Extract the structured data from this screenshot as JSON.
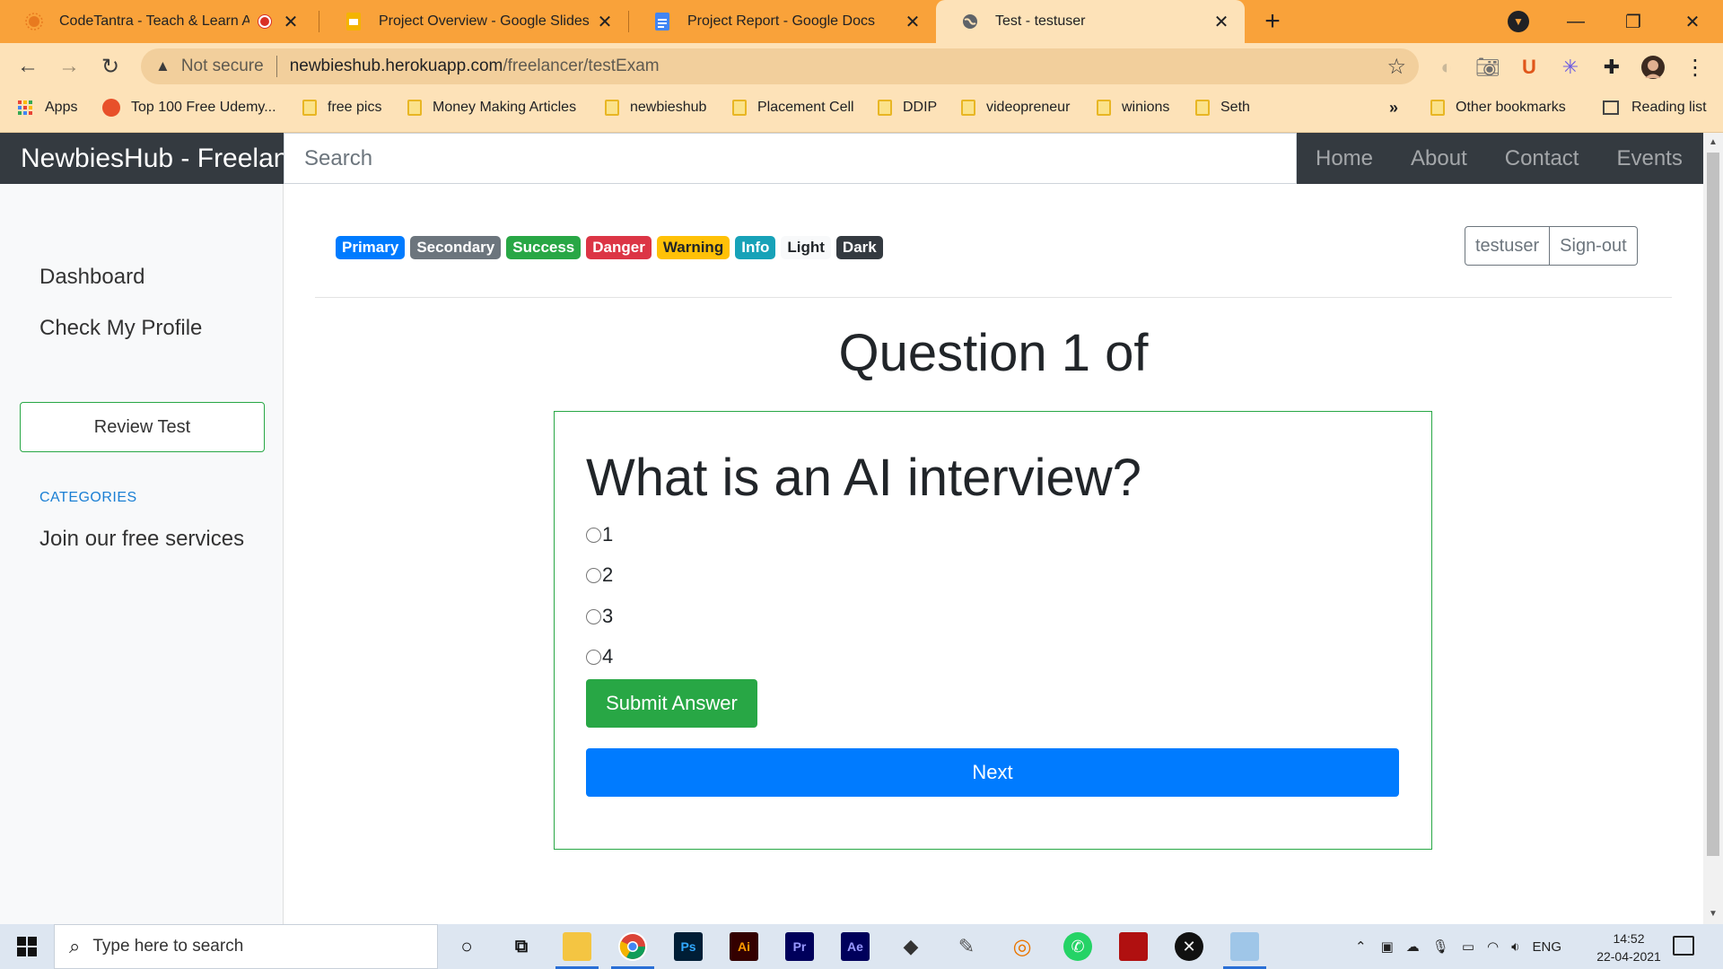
{
  "browser": {
    "tabs": [
      {
        "title": "CodeTantra - Teach & Learn An",
        "active": false
      },
      {
        "title": "Project Overview - Google Slides",
        "active": false
      },
      {
        "title": "Project Report - Google Docs",
        "active": false
      },
      {
        "title": "Test - testuser",
        "active": true
      }
    ],
    "security_label": "Not secure",
    "url_host": "newbieshub.herokuapp.com",
    "url_path": "/freelancer/testExam",
    "bookmarks": [
      "Apps",
      "Top 100 Free Udemy...",
      "free pics",
      "Money Making Articles",
      "newbieshub",
      "Placement Cell",
      "DDIP",
      "videopreneur",
      "winions",
      "Seth"
    ],
    "bookmarks_more": "»",
    "other_bookmarks": "Other bookmarks",
    "reading_list": "Reading list"
  },
  "page": {
    "brand": "NewbiesHub - Freelanc",
    "search_placeholder": "Search",
    "nav": [
      "Home",
      "About",
      "Contact",
      "Events"
    ],
    "sidebar": {
      "dashboard": "Dashboard",
      "profile": "Check My Profile",
      "review": "Review Test",
      "categories": "CATEGORIES",
      "join": "Join our free services"
    },
    "badges": [
      {
        "label": "Primary",
        "color": "#007bff",
        "text": "#ffffff"
      },
      {
        "label": "Secondary",
        "color": "#6c757d",
        "text": "#ffffff"
      },
      {
        "label": "Success",
        "color": "#28a745",
        "text": "#ffffff"
      },
      {
        "label": "Danger",
        "color": "#dc3545",
        "text": "#ffffff"
      },
      {
        "label": "Warning",
        "color": "#ffc107",
        "text": "#212529"
      },
      {
        "label": "Info",
        "color": "#17a2b8",
        "text": "#ffffff"
      },
      {
        "label": "Light",
        "color": "#f8f9fa",
        "text": "#212529"
      },
      {
        "label": "Dark",
        "color": "#343a40",
        "text": "#ffffff"
      }
    ],
    "user": "testuser",
    "signout": "Sign-out",
    "question_header": "Question 1 of",
    "question": "What is an AI interview?",
    "options": [
      "1",
      "2",
      "3",
      "4"
    ],
    "submit": "Submit Answer",
    "next": "Next"
  },
  "taskbar": {
    "search_placeholder": "Type here to search",
    "lang": "ENG",
    "time": "14:52",
    "date": "22-04-2021"
  }
}
